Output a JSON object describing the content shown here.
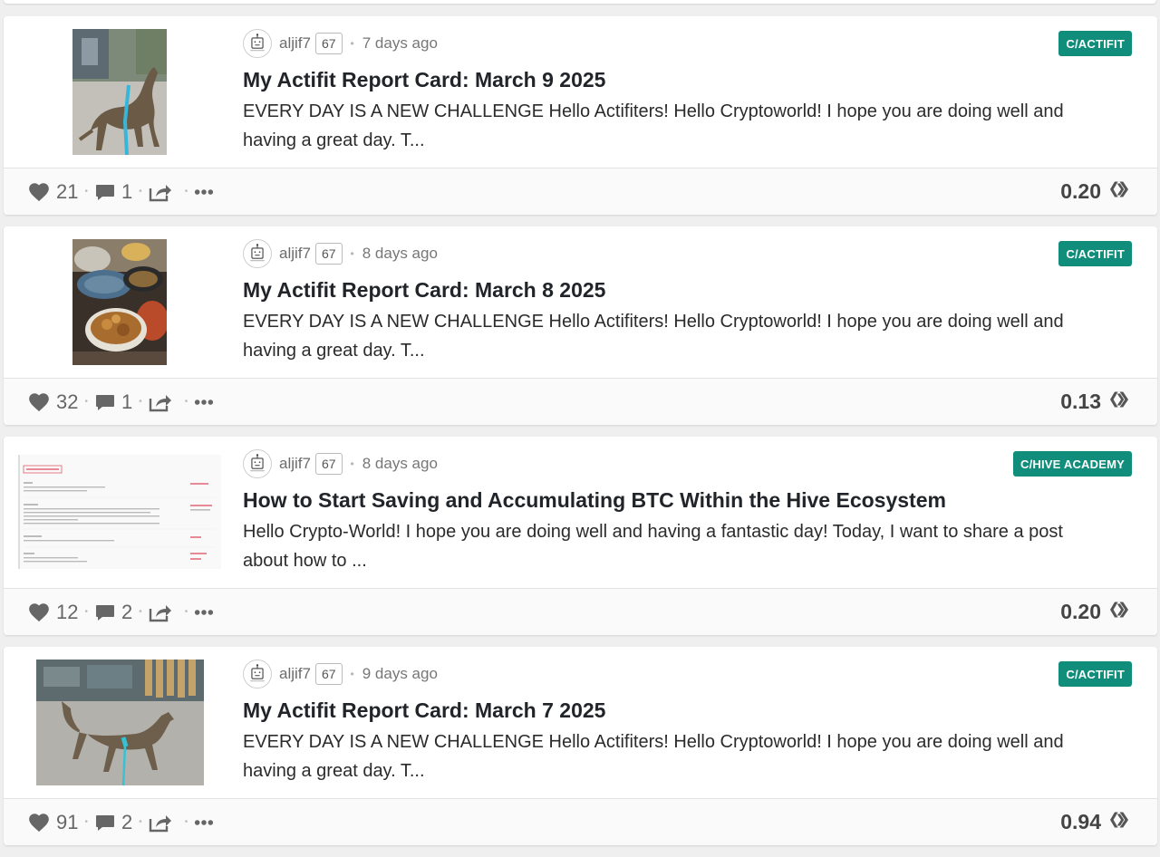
{
  "colors": {
    "community_badge": "#118d7b",
    "background": "#efefef",
    "icon_gray": "#666666"
  },
  "icons": {
    "upvote": "heart-icon",
    "comments": "comment-icon",
    "reblog": "share-icon",
    "menu": "more-dots-icon",
    "payout": "hive-logo-icon",
    "avatar": "robot-avatar-icon"
  },
  "posts": [
    {
      "author": "aljif7",
      "reputation": "67",
      "time": "7 days ago",
      "community": "C/ACTIFIT",
      "title": "My Actifit Report Card: March 9 2025",
      "summary": "EVERY DAY IS A NEW CHALLENGE Hello Actifiters! Hello Cryptoworld! I hope you are doing well and having a great day. T...",
      "votes": "21",
      "comments": "1",
      "payout": "0.20",
      "thumbnail": "dog-photo"
    },
    {
      "author": "aljif7",
      "reputation": "67",
      "time": "8 days ago",
      "community": "C/ACTIFIT",
      "title": "My Actifit Report Card: March 8 2025",
      "summary": "EVERY DAY IS A NEW CHALLENGE Hello Actifiters! Hello Cryptoworld! I hope you are doing well and having a great day. T...",
      "votes": "32",
      "comments": "1",
      "payout": "0.13",
      "thumbnail": "food-photo"
    },
    {
      "author": "aljif7",
      "reputation": "67",
      "time": "8 days ago",
      "community": "C/HIVE ACADEMY",
      "title": "How to Start Saving and Accumulating BTC Within the Hive Ecosystem",
      "summary": "Hello Crypto-World! I hope you are doing well and having a fantastic day! Today, I want to share a post about how to ...",
      "votes": "12",
      "comments": "2",
      "payout": "0.20",
      "thumbnail": "wallet-screenshot"
    },
    {
      "author": "aljif7",
      "reputation": "67",
      "time": "9 days ago",
      "community": "C/ACTIFIT",
      "title": "My Actifit Report Card: March 7 2025",
      "summary": "EVERY DAY IS A NEW CHALLENGE Hello Actifiters! Hello Cryptoworld! I hope you are doing well and having a great day. T...",
      "votes": "91",
      "comments": "2",
      "payout": "0.94",
      "thumbnail": "dog-photo-wide"
    }
  ]
}
